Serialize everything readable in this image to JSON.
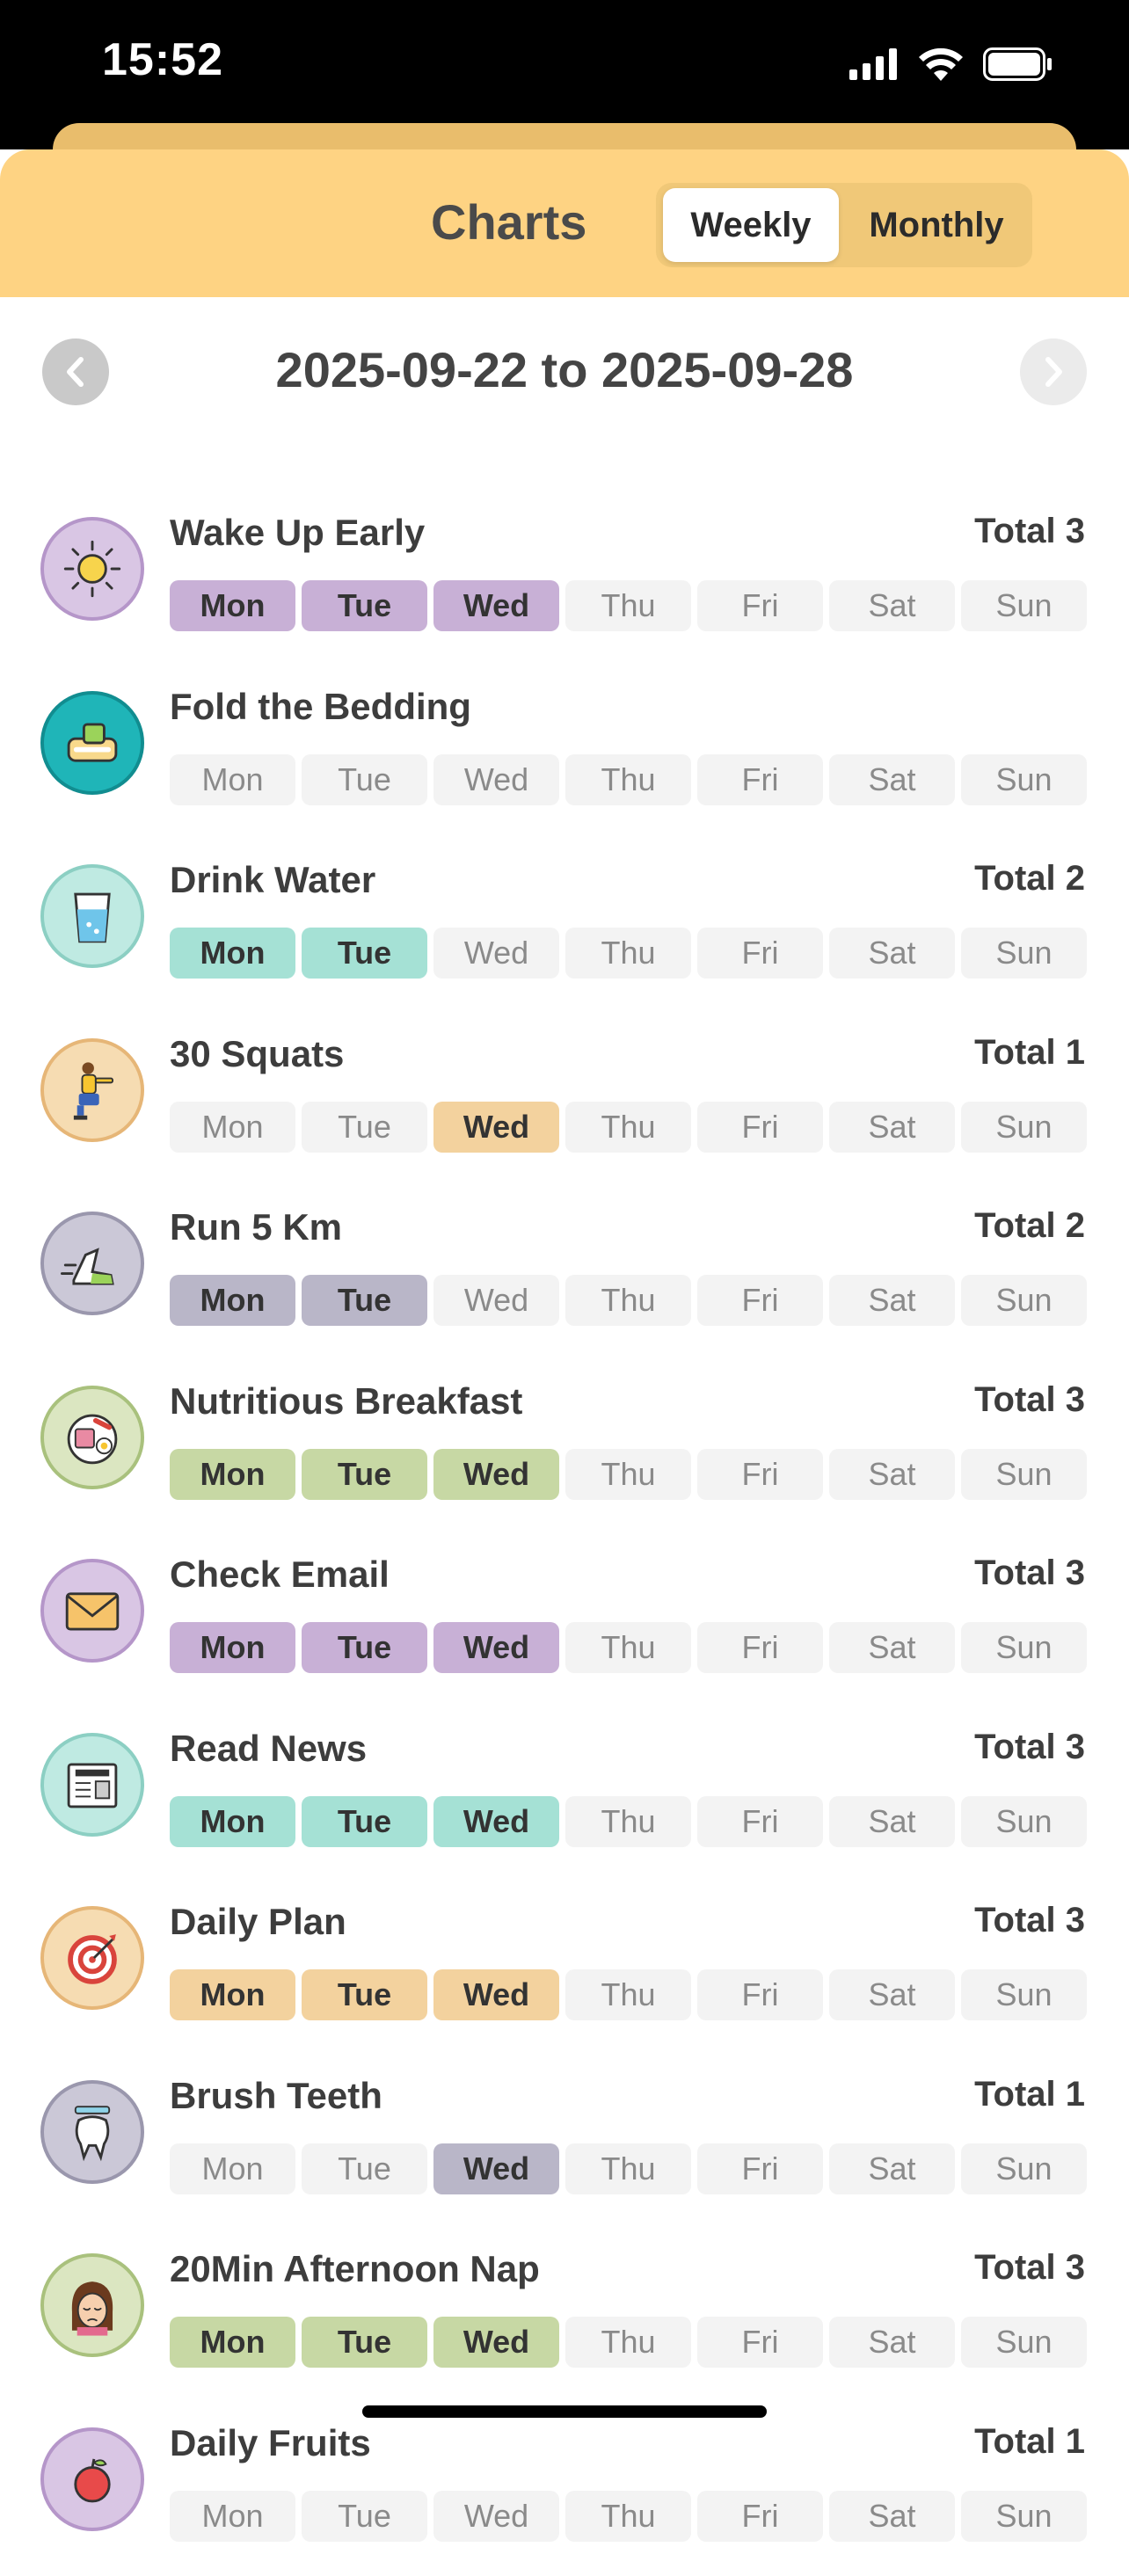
{
  "status": {
    "time": "15:52"
  },
  "header": {
    "title": "Charts",
    "tab_weekly": "Weekly",
    "tab_monthly": "Monthly",
    "selected_tab": "Weekly"
  },
  "range": {
    "text": "2025-09-22 to 2025-09-28",
    "prev_icon": "chevron-left-icon",
    "next_icon": "chevron-right-icon"
  },
  "habits": [
    {
      "name": "Wake Up Early",
      "total": "Total 3",
      "icon": "sun-icon",
      "color": "#c8b0d6",
      "ring": "#b596c9",
      "bg": "#d9c6e4",
      "days": [
        1,
        1,
        1,
        0,
        0,
        0,
        0
      ]
    },
    {
      "name": "Fold the Bedding",
      "total": "",
      "icon": "bedding-icon",
      "color": "#1fb5b8",
      "ring": "#118d90",
      "bg": "#1fb5b8",
      "days": [
        0,
        0,
        0,
        0,
        0,
        0,
        0
      ]
    },
    {
      "name": "Drink Water",
      "total": "Total 2",
      "icon": "water-glass-icon",
      "color": "#a5e1d5",
      "ring": "#8ccfc3",
      "bg": "#bfeae2",
      "days": [
        1,
        1,
        0,
        0,
        0,
        0,
        0
      ]
    },
    {
      "name": "30 Squats",
      "total": "Total 1",
      "icon": "squat-person-icon",
      "color": "#f3d29e",
      "ring": "#e6b677",
      "bg": "#f6dcb2",
      "days": [
        0,
        0,
        1,
        0,
        0,
        0,
        0
      ]
    },
    {
      "name": "Run 5 Km",
      "total": "Total 2",
      "icon": "running-shoe-icon",
      "color": "#b9b6c8",
      "ring": "#9a97ad",
      "bg": "#cbc8d7",
      "days": [
        1,
        1,
        0,
        0,
        0,
        0,
        0
      ]
    },
    {
      "name": "Nutritious Breakfast",
      "total": "Total 3",
      "icon": "breakfast-plate-icon",
      "color": "#c7d8a4",
      "ring": "#a9c17d",
      "bg": "#dbe6c1",
      "days": [
        1,
        1,
        1,
        0,
        0,
        0,
        0
      ]
    },
    {
      "name": "Check Email",
      "total": "Total 3",
      "icon": "envelope-icon",
      "color": "#c8b0d6",
      "ring": "#b596c9",
      "bg": "#d9c6e4",
      "days": [
        1,
        1,
        1,
        0,
        0,
        0,
        0
      ]
    },
    {
      "name": "Read News",
      "total": "Total 3",
      "icon": "newspaper-icon",
      "color": "#a5e1d5",
      "ring": "#8ccfc3",
      "bg": "#bfeae2",
      "days": [
        1,
        1,
        1,
        0,
        0,
        0,
        0
      ]
    },
    {
      "name": "Daily Plan",
      "total": "Total 3",
      "icon": "target-icon",
      "color": "#f3d29e",
      "ring": "#e6b677",
      "bg": "#f6dcb2",
      "days": [
        1,
        1,
        1,
        0,
        0,
        0,
        0
      ]
    },
    {
      "name": "Brush Teeth",
      "total": "Total 1",
      "icon": "tooth-icon",
      "color": "#b9b6c8",
      "ring": "#9a97ad",
      "bg": "#cbc8d7",
      "days": [
        0,
        0,
        1,
        0,
        0,
        0,
        0
      ]
    },
    {
      "name": "20Min Afternoon Nap",
      "total": "Total 3",
      "icon": "sleepy-girl-icon",
      "color": "#c7d8a4",
      "ring": "#a9c17d",
      "bg": "#dbe6c1",
      "days": [
        1,
        1,
        1,
        0,
        0,
        0,
        0
      ]
    },
    {
      "name": "Daily Fruits",
      "total": "Total 1",
      "icon": "fruit-icon",
      "color": "#c8b0d6",
      "ring": "#b596c9",
      "bg": "#d9c6e4",
      "days": [
        0,
        0,
        0,
        0,
        0,
        0,
        0
      ]
    }
  ],
  "weekdays": [
    "Mon",
    "Tue",
    "Wed",
    "Thu",
    "Fri",
    "Sat",
    "Sun"
  ]
}
